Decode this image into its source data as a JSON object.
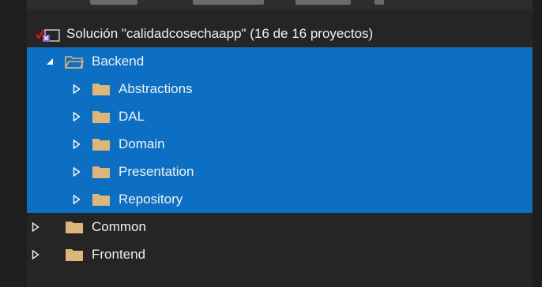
{
  "solution": {
    "label": "Solución \"calidadcosechaapp\" (16 de 16 proyectos)"
  },
  "tree": {
    "backend": {
      "label": "Backend",
      "expanded": true,
      "selected": true
    },
    "backend_children": [
      {
        "label": "Abstractions",
        "selected": true
      },
      {
        "label": "DAL",
        "selected": true
      },
      {
        "label": "Domain",
        "selected": true
      },
      {
        "label": "Presentation",
        "selected": true
      },
      {
        "label": "Repository",
        "selected": true
      }
    ],
    "root_folders": [
      {
        "label": "Common"
      },
      {
        "label": "Frontend"
      }
    ]
  },
  "icons": {
    "solution": "visual-studio-solution-icon",
    "folder": "folder-icon",
    "open_folder": "open-folder-icon",
    "expand": "triangle-right-icon",
    "collapse": "triangle-down-icon",
    "check": "red-check-icon"
  },
  "colors": {
    "background": "#252526",
    "selection": "#0d6fc3",
    "folder": "#dcb67a",
    "text": "#f1f1f1",
    "check": "#e51400",
    "vs_purple": "#865fc5"
  }
}
